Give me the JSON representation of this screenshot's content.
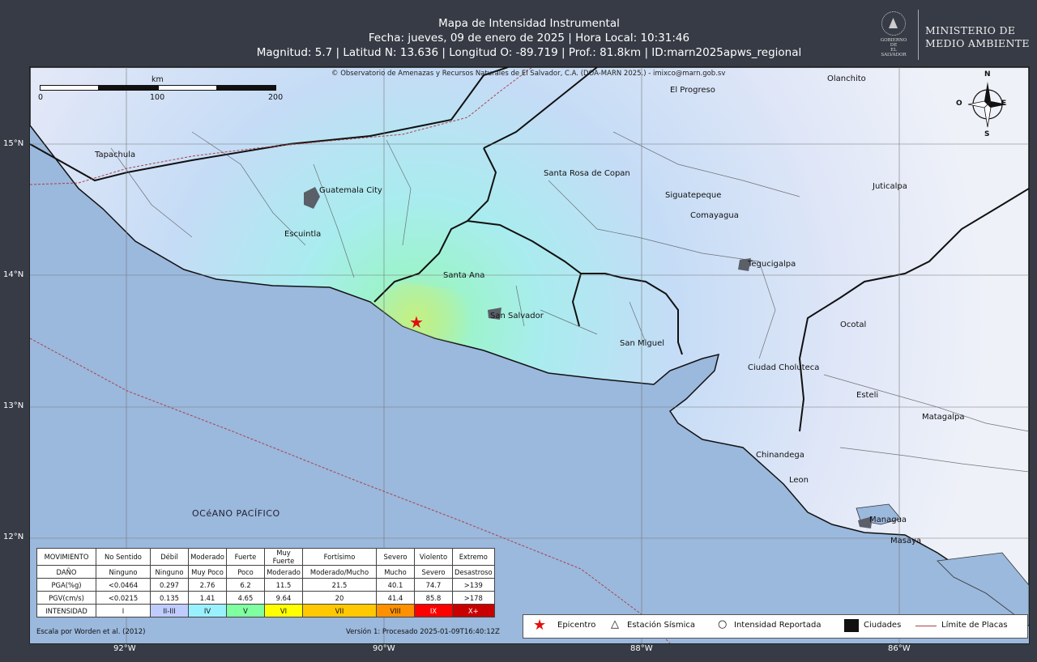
{
  "header": {
    "title": "Mapa de Intensidad Instrumental",
    "line2": "Fecha: jueves, 09 de enero de 2025 | Hora Local: 10:31:46",
    "line3": "Magnitud: 5.7 | Latitud N: 13.636 | Longitud O: -89.719 | Prof.: 81.8km | ID:marn2025apws_regional"
  },
  "logo": {
    "seal_text_1": "GOBIERNO DE",
    "seal_text_2": "EL SALVADOR",
    "ministry_1": "MINISTERIO DE",
    "ministry_2": "MEDIO AMBIENTE"
  },
  "map": {
    "copyright": "© Observatorio de Amenazas y Recursos Naturales de El Salvador, C.A. (DOA-MARN 2025.) - imixco@marn.gob.sv",
    "scale": {
      "unit": "km",
      "ticks": [
        "0",
        "100",
        "200"
      ]
    },
    "compass": {
      "n": "N",
      "s": "S",
      "e": "E",
      "w": "O"
    },
    "ocean_label": "OCéANO PACÍFICO",
    "lat_ticks": [
      "15°N",
      "14°N",
      "13°N",
      "12°N"
    ],
    "lon_ticks": [
      "92°W",
      "90°W",
      "88°W",
      "86°W"
    ],
    "cities": [
      "Olanchito",
      "El Progreso",
      "Tapachula",
      "Santa Rosa de Copan",
      "Guatemala City",
      "Siguatepeque",
      "Juticalpa",
      "Comayagua",
      "Escuintla",
      "Tegucigalpa",
      "Santa Ana",
      "San Salvador",
      "Ocotal",
      "San Miguel",
      "Ciudad Choluteca",
      "Esteli",
      "Matagalpa",
      "Chinandega",
      "Leon",
      "Managua",
      "Masaya"
    ],
    "epicenter": {
      "lat": 13.636,
      "lon": -89.719
    }
  },
  "legend": {
    "rows": [
      {
        "label": "MOVIMIENTO",
        "cells": [
          "No Sentido",
          "Débil",
          "Moderado",
          "Fuerte",
          "Muy Fuerte",
          "Fortísimo",
          "Severo",
          "Violento",
          "Extremo"
        ]
      },
      {
        "label": "DAÑO",
        "cells": [
          "Ninguno",
          "Ninguno",
          "Muy Poco",
          "Poco",
          "Moderado",
          "Moderado/Mucho",
          "Mucho",
          "Severo",
          "Desastroso"
        ]
      },
      {
        "label": "PGA(%g)",
        "cells": [
          "<0.0464",
          "0.297",
          "2.76",
          "6.2",
          "11.5",
          "21.5",
          "40.1",
          "74.7",
          ">139"
        ]
      },
      {
        "label": "PGV(cm/s)",
        "cells": [
          "<0.0215",
          "0.135",
          "1.41",
          "4.65",
          "9.64",
          "20",
          "41.4",
          "85.8",
          ">178"
        ]
      },
      {
        "label": "INTENSIDAD",
        "cells": [
          "I",
          "II-III",
          "IV",
          "V",
          "VI",
          "VII",
          "VIII",
          "IX",
          "X+"
        ]
      }
    ],
    "intensity_colors": [
      "#ffffff",
      "#bfccff",
      "#99f1ff",
      "#80ffa0",
      "#ffff00",
      "#ffc800",
      "#ff9100",
      "#ff0000",
      "#c80000"
    ],
    "escala": "Escala por Worden et al. (2012)",
    "version": "Versión 1: Procesado 2025-01-09T16:40:12Z"
  },
  "key": {
    "epicentro": "Epicentro",
    "estacion": "Estación Sísmica",
    "intensidad": "Intensidad Reportada",
    "ciudades": "Ciudades",
    "placas": "Límite de Placas"
  }
}
